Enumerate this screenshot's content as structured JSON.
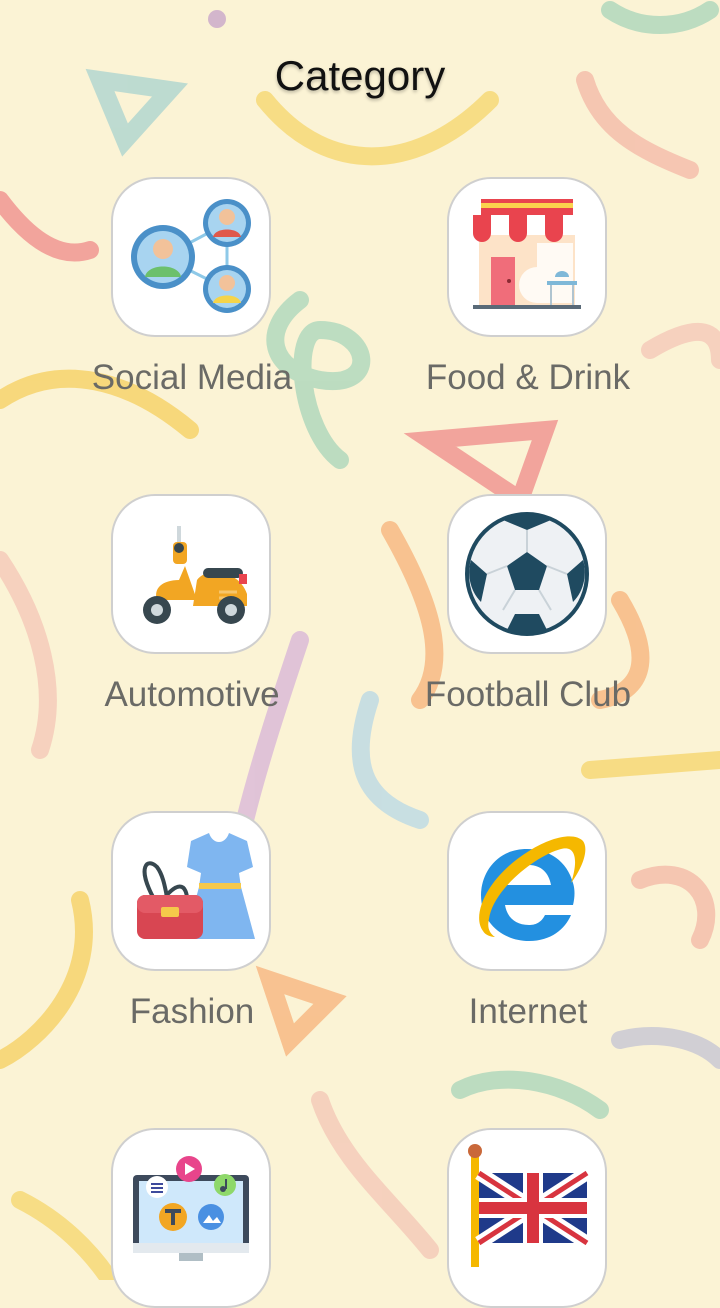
{
  "header": {
    "title": "Category"
  },
  "categories": [
    {
      "label": "Social Media",
      "icon": "social-media-icon"
    },
    {
      "label": "Food & Drink",
      "icon": "shop-icon"
    },
    {
      "label": "Automotive",
      "icon": "scooter-icon"
    },
    {
      "label": "Football Club",
      "icon": "football-icon"
    },
    {
      "label": "Fashion",
      "icon": "dress-bag-icon"
    },
    {
      "label": "Internet",
      "icon": "internet-explorer-icon"
    },
    {
      "label": "",
      "icon": "multimedia-monitor-icon"
    },
    {
      "label": "",
      "icon": "uk-flag-icon"
    }
  ],
  "colors": {
    "background": "#FBF3D5",
    "tile_border": "#CFCFCF",
    "label_text": "#6A6A66",
    "doodle_yellow": "#F6D56A",
    "doodle_green": "#A8D5BA",
    "doodle_pink": "#F4A6A6",
    "doodle_orange": "#F7B27A",
    "doodle_lilac": "#D8B4D8"
  }
}
